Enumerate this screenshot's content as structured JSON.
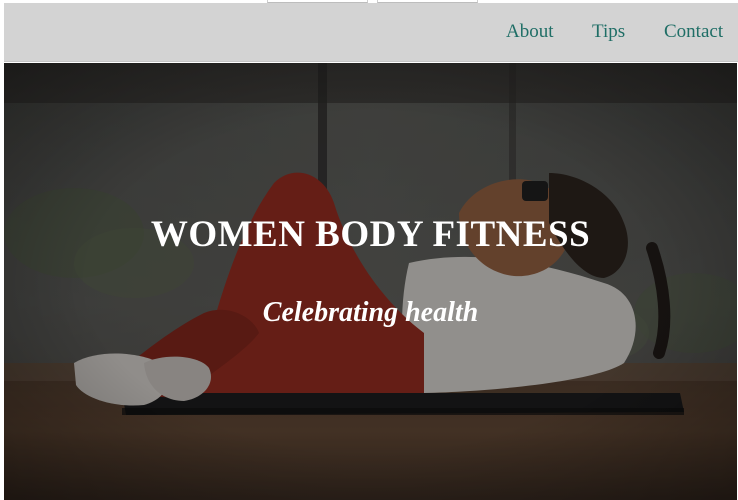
{
  "nav": {
    "links": [
      {
        "label": "About"
      },
      {
        "label": "Tips"
      },
      {
        "label": "Contact"
      }
    ],
    "link_color": "#1f6e66",
    "background": "#d3d3d3"
  },
  "hero": {
    "title": "WOMEN BODY FITNESS",
    "subtitle": "Celebrating health",
    "image": "woman-doing-crunches-photo"
  }
}
